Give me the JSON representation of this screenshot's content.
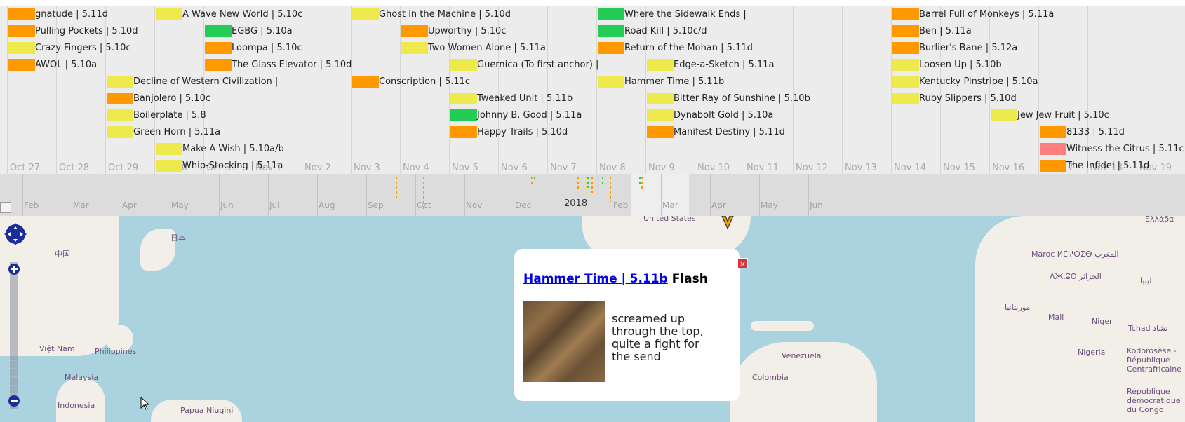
{
  "timeline": {
    "days": [
      {
        "label": "Oct 27"
      },
      {
        "label": "Oct 28"
      },
      {
        "label": "Oct 29"
      },
      {
        "label": "Oct 30"
      },
      {
        "label": "Oct 31"
      },
      {
        "label": "Nov 1"
      },
      {
        "label": "Nov 2"
      },
      {
        "label": "Nov 3"
      },
      {
        "label": "Nov 4"
      },
      {
        "label": "Nov 5"
      },
      {
        "label": "Nov 6"
      },
      {
        "label": "Nov 7"
      },
      {
        "label": "Nov 8"
      },
      {
        "label": "Nov 9"
      },
      {
        "label": "Nov 10"
      },
      {
        "label": "Nov 11"
      },
      {
        "label": "Nov 12"
      },
      {
        "label": "Nov 13"
      },
      {
        "label": "Nov 14"
      },
      {
        "label": "Nov 15"
      },
      {
        "label": "Nov 16"
      },
      {
        "label": "Nov 17"
      },
      {
        "label": "Nov 18"
      },
      {
        "label": "Nov 19"
      }
    ],
    "events": [
      {
        "label": "gnatude | 5.11d",
        "color": "#ff9900",
        "day": 0,
        "row": 0
      },
      {
        "label": "Pulling Pockets | 5.10d",
        "color": "#ff9900",
        "day": 0,
        "row": 1
      },
      {
        "label": "Crazy Fingers | 5.10c",
        "color": "#eeea4e",
        "day": 0,
        "row": 2
      },
      {
        "label": "AWOL | 5.10a",
        "color": "#ff9900",
        "day": 0,
        "row": 3
      },
      {
        "label": "Decline of Western Civilization |",
        "color": "#eeea4e",
        "day": 2,
        "row": 4
      },
      {
        "label": "Banjolero | 5.10c",
        "color": "#ff9900",
        "day": 2,
        "row": 5
      },
      {
        "label": "Boilerplate | 5.8",
        "color": "#eeea4e",
        "day": 2,
        "row": 6
      },
      {
        "label": "Green Horn | 5.11a",
        "color": "#eeea4e",
        "day": 2,
        "row": 7
      },
      {
        "label": "A Wave New World | 5.10c",
        "color": "#eeea4e",
        "day": 3,
        "row": 0
      },
      {
        "label": "Make A Wish | 5.10a/b",
        "color": "#eeea4e",
        "day": 3,
        "row": 8
      },
      {
        "label": "Whip-Stocking | 5.11a",
        "color": "#eeea4e",
        "day": 3,
        "row": 9
      },
      {
        "label": "EGBG | 5.10a",
        "color": "#22cc55",
        "day": 4,
        "row": 1
      },
      {
        "label": "Loompa | 5.10c",
        "color": "#ff9900",
        "day": 4,
        "row": 2
      },
      {
        "label": "The Glass Elevator | 5.10d",
        "color": "#ff9900",
        "day": 4,
        "row": 3
      },
      {
        "label": "Ghost in the Machine | 5.10d",
        "color": "#eeea4e",
        "day": 7,
        "row": 0
      },
      {
        "label": "Conscription | 5.11c",
        "color": "#ff9900",
        "day": 7,
        "row": 4
      },
      {
        "label": "Upworthy | 5.10c",
        "color": "#ff9900",
        "day": 8,
        "row": 1
      },
      {
        "label": "Two Women Alone | 5.11a",
        "color": "#eeea4e",
        "day": 8,
        "row": 2
      },
      {
        "label": "Guernica (To first anchor) |",
        "color": "#eeea4e",
        "day": 9,
        "row": 3
      },
      {
        "label": "Tweaked Unit | 5.11b",
        "color": "#eeea4e",
        "day": 9,
        "row": 5
      },
      {
        "label": "Johnny B. Good | 5.11a",
        "color": "#22cc55",
        "day": 9,
        "row": 6
      },
      {
        "label": "Happy Trails | 5.10d",
        "color": "#ff9900",
        "day": 9,
        "row": 7
      },
      {
        "label": "Where the Sidewalk Ends |",
        "color": "#22cc55",
        "day": 12,
        "row": 0
      },
      {
        "label": "Road Kill | 5.10c/d",
        "color": "#22cc55",
        "day": 12,
        "row": 1
      },
      {
        "label": "Return of the Mohan | 5.11d",
        "color": "#ff9900",
        "day": 12,
        "row": 2
      },
      {
        "label": "Hammer Time | 5.11b",
        "color": "#eeea4e",
        "day": 12,
        "row": 4
      },
      {
        "label": "Edge-a-Sketch | 5.11a",
        "color": "#eeea4e",
        "day": 13,
        "row": 3
      },
      {
        "label": "Bitter Ray of Sunshine | 5.10b",
        "color": "#eeea4e",
        "day": 13,
        "row": 5
      },
      {
        "label": "Dynabolt Gold | 5.10a",
        "color": "#eeea4e",
        "day": 13,
        "row": 6
      },
      {
        "label": "Manifest Destiny | 5.11d",
        "color": "#ff9900",
        "day": 13,
        "row": 7
      },
      {
        "label": "Barrel Full of Monkeys | 5.11a",
        "color": "#ff9900",
        "day": 18,
        "row": 0
      },
      {
        "label": "Ben | 5.11a",
        "color": "#ff9900",
        "day": 18,
        "row": 1
      },
      {
        "label": "Burlier's Bane | 5.12a",
        "color": "#ff9900",
        "day": 18,
        "row": 2
      },
      {
        "label": "Loosen Up | 5.10b",
        "color": "#eeea4e",
        "day": 18,
        "row": 3
      },
      {
        "label": "Kentucky Pinstripe | 5.10a",
        "color": "#eeea4e",
        "day": 18,
        "row": 4
      },
      {
        "label": "Ruby Slippers | 5.10d",
        "color": "#eeea4e",
        "day": 18,
        "row": 5
      },
      {
        "label": "Jew Jew Fruit | 5.10c",
        "color": "#eeea4e",
        "day": 20,
        "row": 6
      },
      {
        "label": "8133 | 5.11d",
        "color": "#ff9900",
        "day": 21,
        "row": 7
      },
      {
        "label": "Witness the Citrus | 5.11c",
        "color": "#ff7f7f",
        "day": 21,
        "row": 8
      },
      {
        "label": "The Infidel | 5.11d",
        "color": "#ff9900",
        "day": 21,
        "row": 9
      }
    ]
  },
  "overview": {
    "months": [
      {
        "label": "Feb"
      },
      {
        "label": "Mar"
      },
      {
        "label": "Apr"
      },
      {
        "label": "May"
      },
      {
        "label": "Jun"
      },
      {
        "label": "Jul"
      },
      {
        "label": "Aug"
      },
      {
        "label": "Sep"
      },
      {
        "label": "Oct"
      },
      {
        "label": "Nov"
      },
      {
        "label": "Dec"
      },
      {
        "label": "2018",
        "year": true
      },
      {
        "label": "Feb"
      },
      {
        "label": "Mar"
      },
      {
        "label": "Apr"
      },
      {
        "label": "May"
      },
      {
        "label": "Jun"
      }
    ],
    "ticks": [
      {
        "month": 7.6,
        "color": "#ff9900",
        "len": 0.6
      },
      {
        "month": 8.15,
        "color": "#ff9900",
        "len": 0.9
      },
      {
        "month": 10.35,
        "color": "#ff9900",
        "len": 0.25
      },
      {
        "month": 10.42,
        "color": "#22cc55",
        "len": 0.15
      },
      {
        "month": 11.3,
        "color": "#ff9900",
        "len": 0.35
      },
      {
        "month": 11.45,
        "color": "#eeea4e",
        "len": 0.5
      },
      {
        "month": 11.5,
        "color": "#22cc55",
        "len": 0.3
      },
      {
        "month": 11.58,
        "color": "#ff9900",
        "len": 0.45
      },
      {
        "month": 11.7,
        "color": "#eeea4e",
        "len": 0.55
      },
      {
        "month": 11.8,
        "color": "#22cc55",
        "len": 0.25
      },
      {
        "month": 11.95,
        "color": "#ff9900",
        "len": 0.7
      },
      {
        "month": 12.55,
        "color": "#22cc55",
        "len": 0.2
      },
      {
        "month": 12.6,
        "color": "#ff9900",
        "len": 0.4
      }
    ]
  },
  "map": {
    "places": [
      {
        "label": "中国"
      },
      {
        "label": "日本"
      },
      {
        "label": "Việt Nam"
      },
      {
        "label": "Philippines"
      },
      {
        "label": "Malaysia"
      },
      {
        "label": "Indonesia"
      },
      {
        "label": "Papua Niugini"
      },
      {
        "label": "United States"
      },
      {
        "label": "Venezuela"
      },
      {
        "label": "Colombia"
      },
      {
        "label": "Maroc ⵍⵎⵖⵔⵉⴱ المغرب"
      },
      {
        "label": "ΛЖ.ⵓO الجزائر"
      },
      {
        "label": "ليبيا"
      },
      {
        "label": "موريتانيا"
      },
      {
        "label": "Mali"
      },
      {
        "label": "Niger"
      },
      {
        "label": "Tchad تشاد"
      },
      {
        "label": "Nigeria"
      },
      {
        "label": "Kodorosêse - République Centrafricaine"
      },
      {
        "label": "République démocratique du Congo"
      },
      {
        "label": "Ελλάδα"
      }
    ]
  },
  "popup": {
    "route_link": "Hammer Time | 5.11b",
    "style": "Flash",
    "close_label": "×",
    "description": "screamed up through the top, quite a fight for the send"
  }
}
